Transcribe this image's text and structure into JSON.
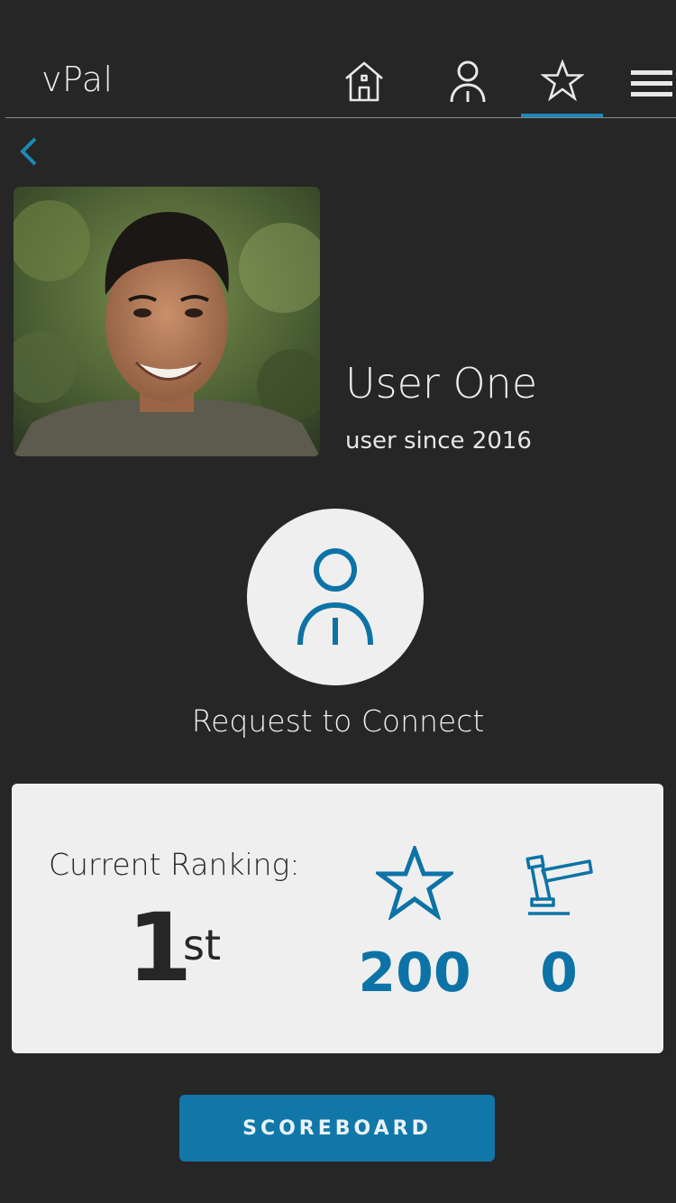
{
  "header": {
    "app_title": "vPal",
    "nav": [
      {
        "name": "home-icon"
      },
      {
        "name": "profile-icon"
      },
      {
        "name": "star-icon",
        "active": true
      },
      {
        "name": "menu-icon"
      }
    ],
    "accent_color": "#1d88b6"
  },
  "profile": {
    "name": "User One",
    "since": "user since 2016"
  },
  "connect": {
    "label": "Request to Connect"
  },
  "ranking": {
    "title": "Current Ranking:",
    "position": "1",
    "suffix": "st",
    "points": "200",
    "flags": "0",
    "value_color": "#0d73a6"
  },
  "actions": {
    "scoreboard_label": "SCOREBOARD"
  }
}
